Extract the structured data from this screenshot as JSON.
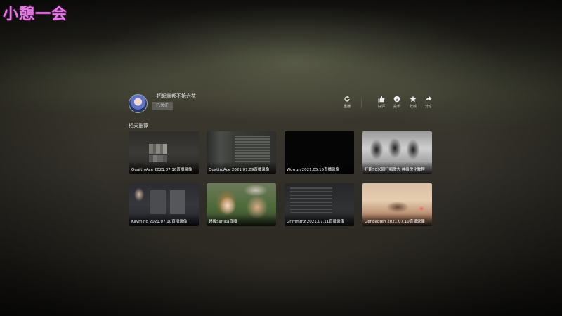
{
  "watermark": "小憩一会",
  "author": {
    "name": "一把起就都不抢六花",
    "follow_label": "已关注"
  },
  "actions": [
    {
      "icon": "replay-icon",
      "label": "重播"
    },
    {
      "icon": "thumbs-up-icon",
      "label": "好评"
    },
    {
      "icon": "coin-icon",
      "label": "投币"
    },
    {
      "icon": "star-icon",
      "label": "收藏"
    },
    {
      "icon": "share-icon",
      "label": "分享"
    }
  ],
  "section_title": "相关推荐",
  "videos": [
    {
      "title": "QuattroAce 2021.07.10直播录像"
    },
    {
      "title": "QuattroAce 2021.07.09直播录像"
    },
    {
      "title": "Worrun 2021.05.15直播录像"
    },
    {
      "title": "狂跑50米回行唱歌大 神级优化教程"
    },
    {
      "title": "Kaymind 2021.07.10直播录像"
    },
    {
      "title": "超级Sanika直播"
    },
    {
      "title": "Grimmmz 2021.07.11直播录像"
    },
    {
      "title": "Genbapten 2021.07.10直播录像"
    }
  ]
}
